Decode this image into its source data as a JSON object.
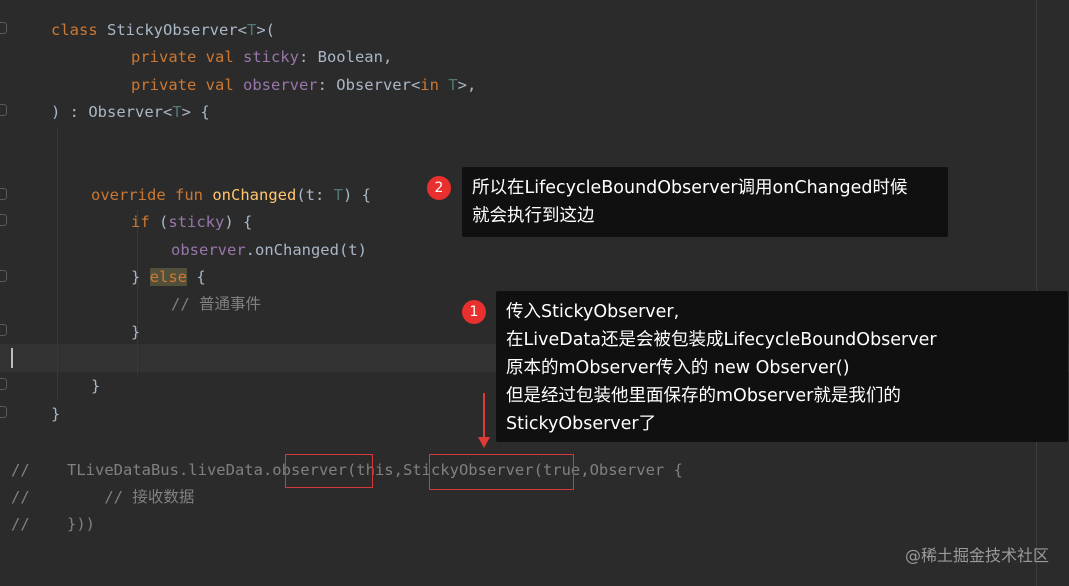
{
  "code": {
    "l1": {
      "kw": "class ",
      "name": "StickyObserver<",
      "tp": "T",
      "rest": ">("
    },
    "l2": {
      "kw": "private val ",
      "prop": "sticky",
      "rest": ": Boolean,"
    },
    "l3": {
      "kw": "private val ",
      "prop": "observer",
      "mid": ": Observer<",
      "kw2": "in ",
      "tp": "T",
      "rest": ">,"
    },
    "l4": {
      "a": ") : Observer<",
      "tp": "T",
      "b": "> {"
    },
    "l5": {
      "kw": "override fun ",
      "fn": "onChanged",
      "a": "(t: ",
      "tp": "T",
      "b": ") {"
    },
    "l6": {
      "kw": "if ",
      "a": "(",
      "prop": "sticky",
      "b": ") {"
    },
    "l7": {
      "prop": "observer",
      "a": ".onChanged(t)"
    },
    "l8": {
      "a": "} ",
      "kw": "else",
      "b": " {"
    },
    "l9": {
      "comment": "// 普通事件"
    },
    "l10": {
      "a": "}"
    },
    "l11": {
      "a": "}"
    },
    "l12": {
      "a": "}"
    },
    "c1": {
      "prefix": "//    TLiveDataBus.liveData.",
      "boxed1": "observer",
      "mid": "(this,",
      "boxed2": "StickyObserver",
      "rest": "(true,Observer {"
    },
    "c2": {
      "prefix": "//        ",
      "comment": "// 接收数据"
    },
    "c3": {
      "text": "//    }))"
    }
  },
  "annotations": {
    "note2": {
      "badge": "2",
      "text": "所以在LifecycleBoundObserver调用onChanged时候\n就会执行到这边"
    },
    "note1": {
      "badge": "1",
      "text": "传入StickyObserver,\n在LiveData还是会被包装成LifecycleBoundObserver\n原本的mObserver传入的 new Observer()\n但是经过包装他里面保存的mObserver就是我们的\nStickyObserver了"
    }
  },
  "colors": {
    "accent": "#e8302e",
    "background": "#2b2b2b",
    "keyword": "#cc7832",
    "function": "#ffc66d",
    "property": "#9876aa"
  },
  "watermark": "@稀土掘金技术社区"
}
